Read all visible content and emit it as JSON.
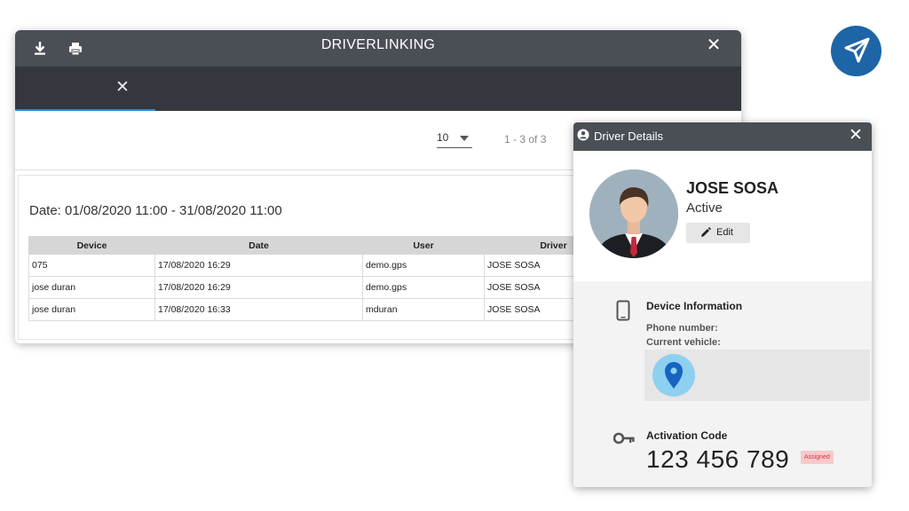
{
  "window": {
    "title": "DRIVERLINKING",
    "download_icon": "download-icon",
    "print_icon": "print-icon",
    "close_icon": "close-icon",
    "close_glyph": "✕"
  },
  "tabs": [
    {
      "label": "",
      "close_glyph": "✕",
      "active": true
    }
  ],
  "pager": {
    "page_size": "10",
    "range": "1 - 3 of 3"
  },
  "report": {
    "date_range": "Date: 01/08/2020 11:00 - 31/08/2020 11:00",
    "columns": [
      "Device",
      "Date",
      "User",
      "Driver"
    ],
    "rows": [
      [
        "075",
        "17/08/2020 16:29",
        "demo.gps",
        "JOSE SOSA"
      ],
      [
        "jose duran",
        "17/08/2020 16:29",
        "demo.gps",
        "JOSE SOSA"
      ],
      [
        "jose duran",
        "17/08/2020 16:33",
        "mduran",
        "JOSE SOSA"
      ]
    ]
  },
  "driver_panel": {
    "title": "Driver Details",
    "close_glyph": "✕",
    "name": "JOSE SOSA",
    "status": "Active",
    "edit_label": "Edit",
    "device_title": "Device Information",
    "phone_label": "Phone number:",
    "vehicle_label": "Current vehicle:",
    "activation_title": "Activation Code",
    "activation_code": "123 456 789",
    "badge": "Assigned"
  },
  "colors": {
    "titlebar": "#4a4e55",
    "tabbar": "#34373d",
    "tab_indicator": "#2b88d8",
    "nav_button": "#1d65a6",
    "badge_bg": "#f7c9cc",
    "badge_text": "#dd3333",
    "pin": "#1565c0",
    "pin_circle": "#8ed0f0"
  }
}
